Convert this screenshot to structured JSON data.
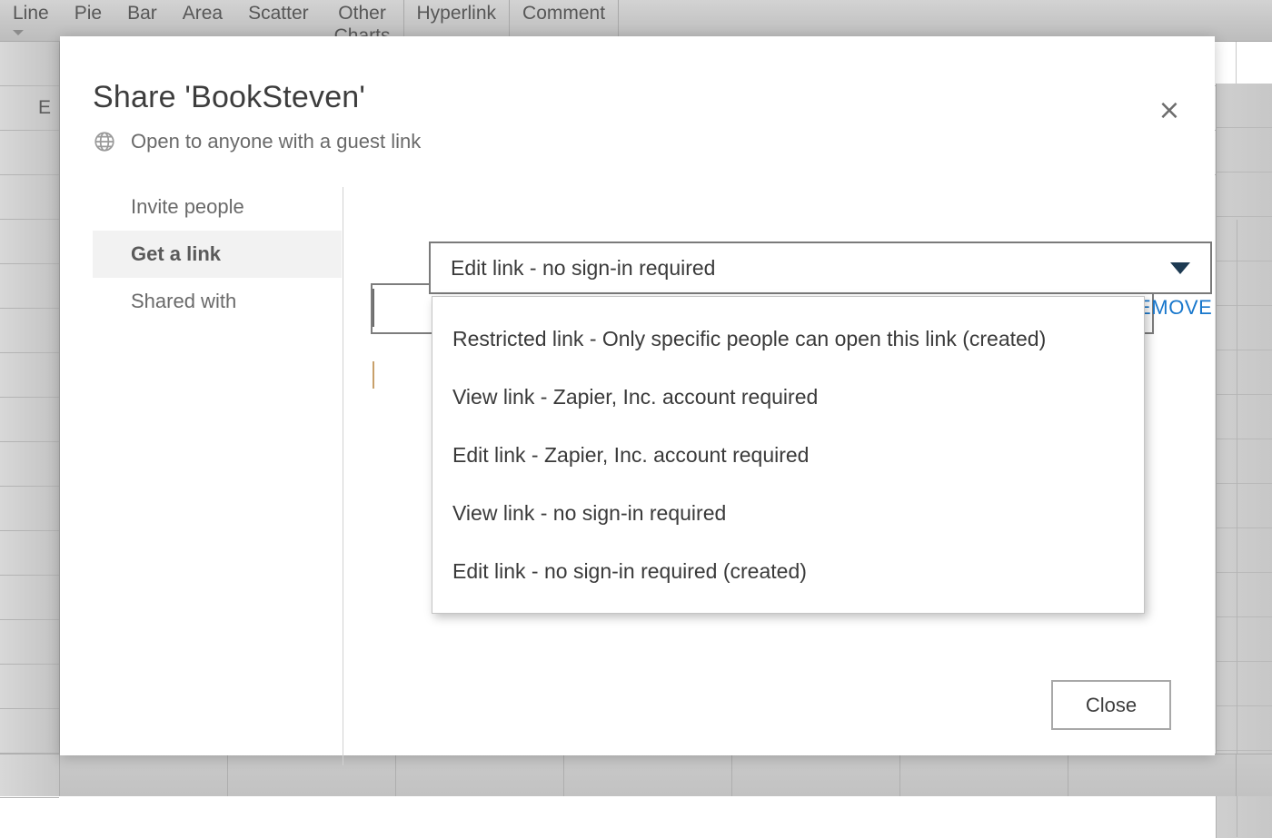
{
  "background": {
    "ribbon_items": [
      {
        "label": "Line",
        "has_caret": true
      },
      {
        "label": "Pie",
        "has_caret": false
      },
      {
        "label": "Bar",
        "has_caret": false
      },
      {
        "label": "Area",
        "has_caret": false
      },
      {
        "label": "Scatter",
        "has_caret": false
      },
      {
        "label": "Other",
        "sub": "Charts",
        "has_caret": false
      },
      {
        "label": "Hyperlink",
        "has_caret": false
      },
      {
        "label": "Comment",
        "has_caret": false
      }
    ],
    "row_headers": [
      "",
      "E",
      "",
      "",
      "",
      "",
      "",
      "",
      "",
      "",
      "",
      "",
      "",
      "",
      "",
      "",
      ""
    ]
  },
  "dialog": {
    "title": "Share 'BookSteven'",
    "close_x": "×",
    "globe_icon": "globe-icon",
    "subtitle": "Open to anyone with a guest link",
    "nav": {
      "items": [
        {
          "label": "Invite people",
          "active": false
        },
        {
          "label": "Get a link",
          "active": true
        },
        {
          "label": "Shared with",
          "active": false
        }
      ]
    },
    "panel": {
      "link_type_select": {
        "selected": "Edit link - no sign-in required",
        "expanded": true,
        "arrow_icon": "chevron-down-icon",
        "options": [
          "Restricted link - Only specific people can open this link (created)",
          "View link - Zapier, Inc. account required",
          "Edit link - Zapier, Inc. account required",
          "View link - no sign-in required",
          "Edit link - no sign-in required (created)"
        ]
      },
      "remove_label": "EMOVE"
    },
    "footer": {
      "close_label": "Close"
    }
  },
  "colors": {
    "accent_link": "#1877cc",
    "select_arrow": "#1d3a52",
    "nav_active_bg": "#f2f2f2",
    "dialog_bg": "#ffffff"
  }
}
